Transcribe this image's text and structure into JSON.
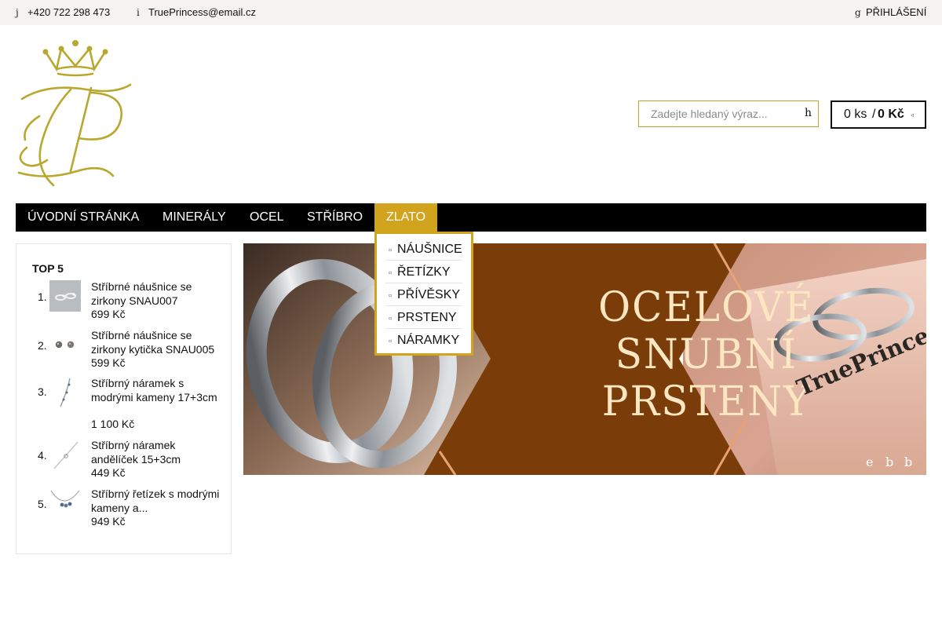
{
  "topbar": {
    "phone_icon": "j",
    "phone_icon_name": "phone-icon",
    "phone": "+420 722 298 473",
    "email_icon": "i",
    "email_icon_name": "mail-icon",
    "email": "TruePrincess@email.cz",
    "login_icon": "g",
    "login_icon_name": "user-icon",
    "login": "PŘIHLÁŠENÍ"
  },
  "search": {
    "placeholder": "Zadejte hledaný výraz...",
    "button_glyph": "h",
    "button_icon_name": "search-icon"
  },
  "cart": {
    "count": "0 ks",
    "separator": "/",
    "price": "0 Kč",
    "icon_glyph": "◃",
    "icon_name": "cart-icon"
  },
  "nav": {
    "items": [
      {
        "label": "ÚVODNÍ STRÁNKA"
      },
      {
        "label": "MINERÁLY"
      },
      {
        "label": "OCEL"
      },
      {
        "label": "STŘÍBRO"
      },
      {
        "label": "ZLATO",
        "active": true
      }
    ]
  },
  "dropdown": {
    "bullet": "▫",
    "items": [
      "NÁUŠNICE",
      "ŘETÍZKY",
      "PŘÍVĚSKY",
      "PRSTENY",
      "NÁRAMKY"
    ]
  },
  "top5": {
    "title": "TOP 5",
    "items": [
      {
        "rank": "1.",
        "name": "Stříbrné náušnice se zirkony SNAU007",
        "price": "699 Kč"
      },
      {
        "rank": "2.",
        "name": "Stříbrné náušnice se zirkony kytička SNAU005",
        "price": "599 Kč"
      },
      {
        "rank": "3.",
        "name": "Stříbrný náramek s modrými kameny 17+3cm",
        "price": "1 100 Kč"
      },
      {
        "rank": "4.",
        "name": "Stříbrný náramek andělíček 15+3cm",
        "price": "449 Kč"
      },
      {
        "rank": "5.",
        "name": "Stříbrný řetízek s modrými kameny a...",
        "price": "949 Kč"
      }
    ]
  },
  "banner": {
    "line1": "OCELOVÉ",
    "line2": "SNUBNÍ",
    "line3": "PRSTENY",
    "brand": "TruePrincess",
    "nav_glyphs": [
      "e",
      "b",
      "b"
    ]
  },
  "colors": {
    "gold": "#d2a31c",
    "logo_gold": "#b8a82e",
    "banner_brown": "#7a3d0a",
    "banner_text": "#fde7c2",
    "nav_bg": "#000000",
    "topbar_bg": "#f6f2f0"
  }
}
